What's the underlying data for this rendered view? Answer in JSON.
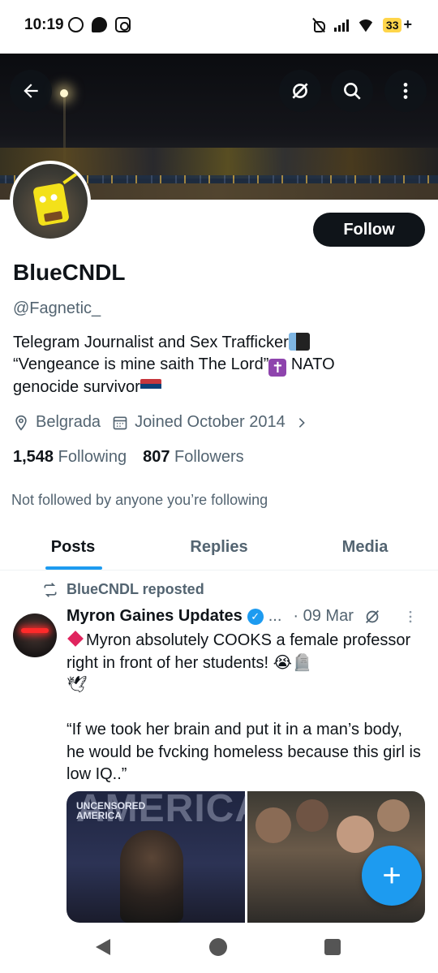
{
  "status_bar": {
    "time": "10:19",
    "battery": "33",
    "charging": "+",
    "app_icons": [
      "whatsapp-icon",
      "chat-bubble-icon",
      "instagram-icon"
    ]
  },
  "header": {
    "back_icon": "arrow-left-icon",
    "actions": [
      "lists-icon",
      "search-icon",
      "more-vertical-icon"
    ]
  },
  "profile": {
    "follow_label": "Follow",
    "display_name": "BlueCNDL",
    "handle": "@Fagnetic_",
    "bio_line1": "Telegram Journalist and Sex Trafficker",
    "bio_line2": "“Vengeance is mine saith The Lord”",
    "bio_line2b": " NATO",
    "bio_line3": "genocide survivor",
    "location": "Belgrada",
    "joined": "Joined October 2014",
    "following_count": "1,548",
    "following_label": "Following",
    "followers_count": "807",
    "followers_label": "Followers",
    "not_followed": "Not followed by anyone you’re following"
  },
  "tabs": [
    {
      "label": "Posts",
      "active": true
    },
    {
      "label": "Replies",
      "active": false
    },
    {
      "label": "Media",
      "active": false
    }
  ],
  "post": {
    "repost_label": "BlueCNDL reposted",
    "author": "Myron Gaines Updates",
    "ellipsis": "...",
    "date": "· 09 Mar",
    "text_line1": "Myron absolutely COOKS a female professor right in front of her students!",
    "quote": "“If we took her brain and put it in a man’s body, he would be fvcking homeless because this girl is low IQ..”",
    "media_left_watermark": "AMERICA",
    "media_logo_line1": "UNCENSORED",
    "media_logo_line2": "AMERICA"
  },
  "fab_label": "+",
  "colors": {
    "accent": "#1d9bf0",
    "text": "#0f1419",
    "muted": "#536471"
  }
}
